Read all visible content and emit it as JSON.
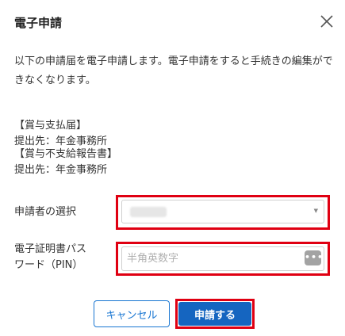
{
  "dialog": {
    "title": "電子申請",
    "close_icon": "close-icon",
    "description": "以下の申請届を電子申請します。電子申請をすると手続きの編集ができなくなります。"
  },
  "filings": [
    {
      "heading": "【賞与支払届】",
      "destination": "提出先：年金事務所"
    },
    {
      "heading": "【賞与不支給報告書】",
      "destination": "提出先：年金事務所"
    }
  ],
  "form": {
    "applicant_label": "申請者の選択",
    "applicant_value": "",
    "password_label_line1": "電子証明書パス",
    "password_label_line2": "ワード（PIN）",
    "password_placeholder": "半角英数字",
    "password_toggle_icon": "show-password-icon",
    "password_toggle_text": "•••"
  },
  "buttons": {
    "cancel": "キャンセル",
    "submit": "申請する"
  },
  "colors": {
    "accent": "#1565c0",
    "highlight": "#e00012"
  }
}
